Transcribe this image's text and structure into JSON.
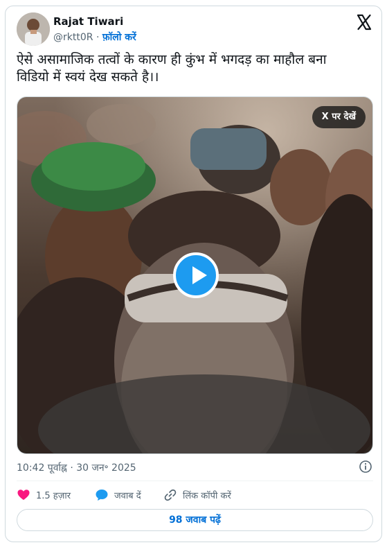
{
  "author": {
    "name": "Rajat Tiwari",
    "handle": "@rktt0R",
    "separator": "·",
    "follow_label": "फ़ॉलो करें"
  },
  "tweet": {
    "text_line1": "ऐसे असामाजिक तत्वों के कारण ही कुंभ में भगदड़ का माहौल बना",
    "text_line2": "विडियो में स्वयं देख सकते है।।"
  },
  "media": {
    "view_on_x_label": "X पर देखें"
  },
  "meta": {
    "timestamp": "10:42 पूर्वाह्न · 30 जन॰ 2025"
  },
  "actions": {
    "like_count": "1.5 हज़ार",
    "reply_label": "जवाब दें",
    "copy_link_label": "लिंक कॉपी करें"
  },
  "footer": {
    "read_replies_label": "98 जवाब पढ़ें"
  },
  "colors": {
    "accent": "#1d9bf0",
    "link": "#006fd6",
    "like": "#f91880",
    "muted": "#536471"
  },
  "icons": {
    "platform": "x-logo-icon",
    "play": "play-icon",
    "info": "info-icon",
    "like": "heart-icon",
    "reply": "speech-bubble-icon",
    "copy_link": "link-icon"
  }
}
